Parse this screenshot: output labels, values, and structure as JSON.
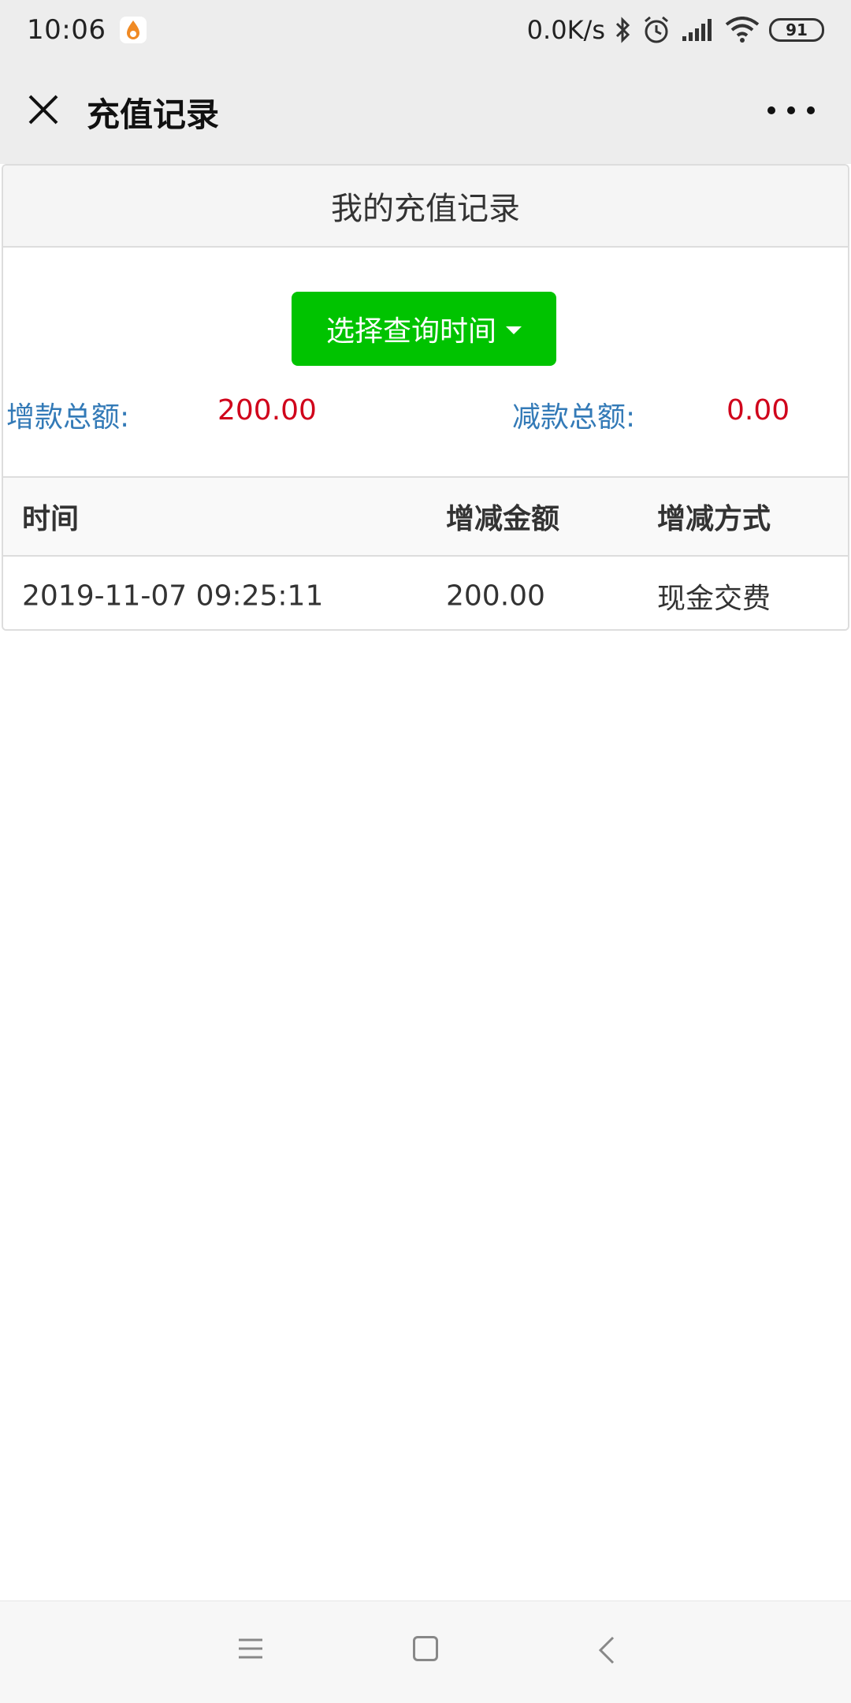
{
  "status_bar": {
    "time": "10:06",
    "net_speed": "0.0K/s",
    "battery": "91",
    "icons": [
      "app-notification-icon",
      "bluetooth-icon",
      "alarm-icon",
      "signal-icon",
      "wifi-icon",
      "battery-icon"
    ]
  },
  "nav": {
    "title": "充值记录",
    "close_icon": "close-icon",
    "more_icon": "more-icon"
  },
  "panel": {
    "header": "我的充值记录",
    "query_button": "选择查询时间",
    "increase_label": "增款总额:",
    "increase_value": "200.00",
    "decrease_label": "减款总额:",
    "decrease_value": "0.00"
  },
  "table": {
    "headers": [
      "时间",
      "增减金额",
      "增减方式"
    ],
    "rows": [
      [
        "2019-11-07 09:25:11",
        "200.00",
        "现金交费"
      ]
    ]
  },
  "colors": {
    "accent_green": "#00c300",
    "label_blue": "#337ab7",
    "value_red": "#d0021b"
  }
}
